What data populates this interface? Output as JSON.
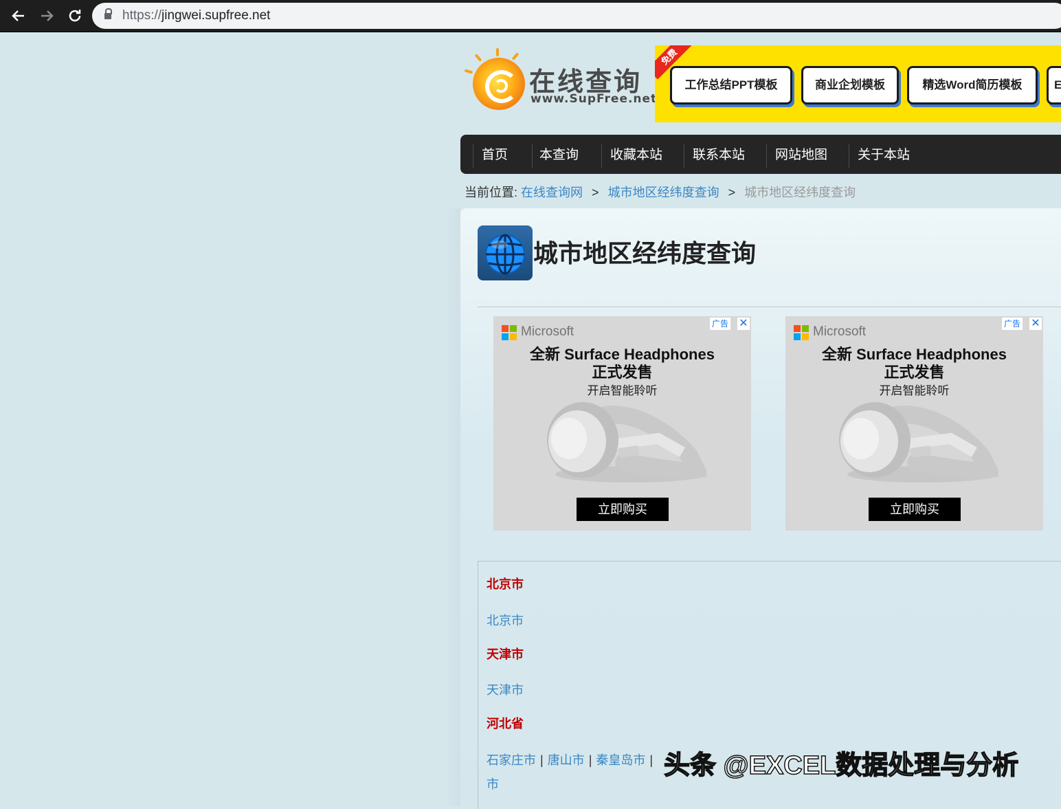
{
  "browser": {
    "url_scheme": "https://",
    "url_host": "jingwei.supfree.net",
    "back_icon": "arrow-left-icon",
    "forward_icon": "arrow-right-icon",
    "reload_icon": "reload-icon"
  },
  "header": {
    "logo_title": "在线查询",
    "logo_subtitle": "www.SupFree.net",
    "banner": {
      "badge": "免费",
      "buttons": [
        "工作总结PPT模板",
        "商业企划模板",
        "精选Word简历模板",
        "E"
      ]
    }
  },
  "nav": {
    "items": [
      "首页",
      "本查询",
      "收藏本站",
      "联系本站",
      "网站地图",
      "关于本站"
    ]
  },
  "breadcrumb": {
    "prefix": "当前位置:",
    "links": [
      "在线查询网",
      "城市地区经纬度查询"
    ],
    "current": "城市地区经纬度查询",
    "separator": ">"
  },
  "main": {
    "title": "城市地区经纬度查询",
    "title_icon": "globe-icon"
  },
  "ads": [
    {
      "mark": "广告",
      "close": "✕",
      "brand": "Microsoft",
      "headline": "全新 Surface Headphones",
      "headline2": "正式发售",
      "sub": "开启智能聆听",
      "cta": "立即购买"
    },
    {
      "mark": "广告",
      "close": "✕",
      "brand": "Microsoft",
      "headline": "全新 Surface Headphones",
      "headline2": "正式发售",
      "sub": "开启智能聆听",
      "cta": "立即购买"
    }
  ],
  "regions": [
    {
      "province": "北京市",
      "cities": [
        "北京市"
      ]
    },
    {
      "province": "天津市",
      "cities": [
        "天津市"
      ]
    },
    {
      "province": "河北省",
      "cities": [
        "石家庄市",
        "唐山市",
        "秦皇岛市"
      ],
      "wrap_tail": "市"
    }
  ],
  "colors": {
    "accent_link": "#3b86c4",
    "province_red": "#c00000",
    "nav_bg": "#252525",
    "banner_yellow": "#ffe100"
  },
  "watermark": "头条 @EXCEL数据处理与分析"
}
